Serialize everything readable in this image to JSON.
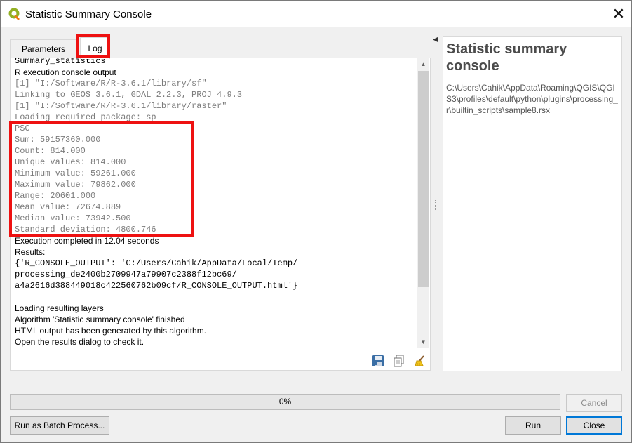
{
  "window": {
    "title": "Statistic Summary Console",
    "close_glyph": "✕"
  },
  "tabs": [
    {
      "label": "Parameters"
    },
    {
      "label": "Log"
    }
  ],
  "log": {
    "lines": [
      {
        "text": "Summary_statistics",
        "font": "mono",
        "color": "black"
      },
      {
        "text": "R execution console output",
        "font": "sans",
        "color": "black"
      },
      {
        "text": "[1] \"I:/Software/R/R-3.6.1/library/sf\"",
        "font": "mono",
        "color": "grey"
      },
      {
        "text": "Linking to GEOS 3.6.1, GDAL 2.2.3, PROJ 4.9.3",
        "font": "mono",
        "color": "grey"
      },
      {
        "text": "[1] \"I:/Software/R/R-3.6.1/library/raster\"",
        "font": "mono",
        "color": "grey"
      },
      {
        "text": "Loading required package: sp",
        "font": "mono",
        "color": "grey"
      },
      {
        "text": "PSC",
        "font": "mono",
        "color": "grey"
      },
      {
        "text": "Sum: 59157360.000",
        "font": "mono",
        "color": "grey"
      },
      {
        "text": "Count: 814.000",
        "font": "mono",
        "color": "grey"
      },
      {
        "text": "Unique values: 814.000",
        "font": "mono",
        "color": "grey"
      },
      {
        "text": "Minimum value: 59261.000",
        "font": "mono",
        "color": "grey"
      },
      {
        "text": "Maximum value: 79862.000",
        "font": "mono",
        "color": "grey"
      },
      {
        "text": "Range: 20601.000",
        "font": "mono",
        "color": "grey"
      },
      {
        "text": "Mean value: 72674.889",
        "font": "mono",
        "color": "grey"
      },
      {
        "text": "Median value: 73942.500",
        "font": "mono",
        "color": "grey"
      },
      {
        "text": "Standard deviation: 4800.746",
        "font": "mono",
        "color": "grey"
      },
      {
        "text": "Execution completed in 12.04 seconds",
        "font": "sans",
        "color": "black"
      },
      {
        "text": "Results:",
        "font": "sans",
        "color": "black"
      },
      {
        "text": "{'R_CONSOLE_OUTPUT': 'C:/Users/Cahik/AppData/Local/Temp/",
        "font": "mono",
        "color": "black"
      },
      {
        "text": "processing_de2400b2709947a79907c2388f12bc69/",
        "font": "mono",
        "color": "black"
      },
      {
        "text": "a4a2616d388449018c422560762b09cf/R_CONSOLE_OUTPUT.html'}",
        "font": "mono",
        "color": "black"
      },
      {
        "text": "",
        "font": "sans",
        "color": "black"
      },
      {
        "text": "Loading resulting layers",
        "font": "sans",
        "color": "black"
      },
      {
        "text": "Algorithm 'Statistic summary console' finished",
        "font": "sans",
        "color": "black"
      },
      {
        "text": "HTML output has been generated by this algorithm.",
        "font": "sans",
        "color": "black"
      },
      {
        "text": "Open the results dialog to check it.",
        "font": "sans",
        "color": "black"
      }
    ]
  },
  "help": {
    "title": "Statistic summary console",
    "path": "C:\\Users\\Cahik\\AppData\\Roaming\\QGIS\\QGIS3\\profiles\\default\\python\\plugins\\processing_r\\builtin_scripts\\sample8.rsx"
  },
  "progress": {
    "value": 0,
    "label": "0%"
  },
  "buttons": {
    "cancel": "Cancel",
    "batch": "Run as Batch Process...",
    "run": "Run",
    "close": "Close"
  },
  "colors": {
    "highlight": "#ee1111",
    "log_grey": "#7b7b7b",
    "focus_blue": "#0078d7"
  }
}
